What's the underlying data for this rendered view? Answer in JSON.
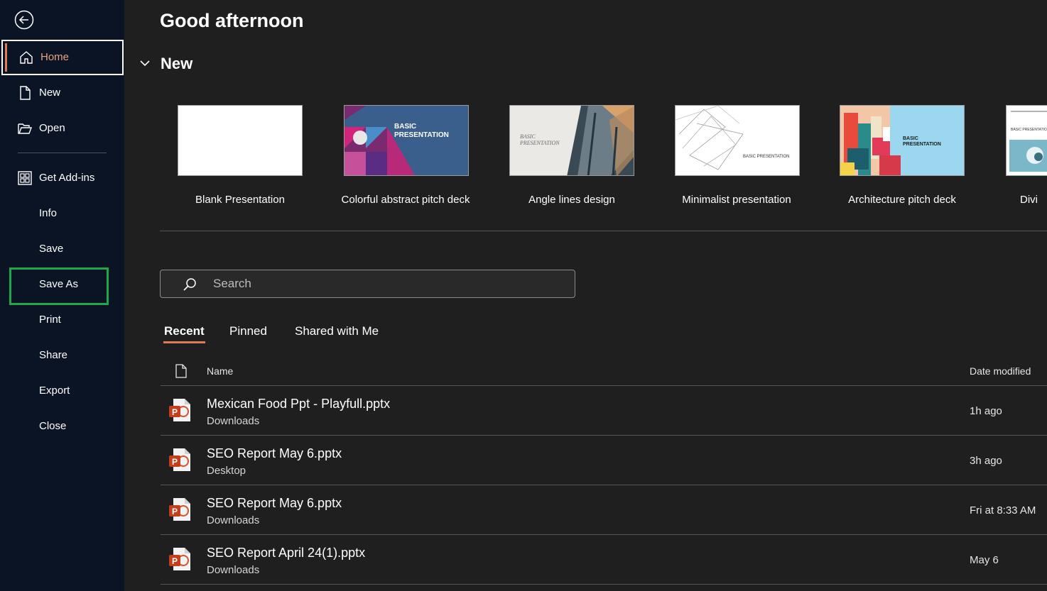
{
  "greeting": "Good afternoon",
  "sidebar": {
    "back_icon": "back-arrow-icon",
    "items": [
      {
        "label": "Home",
        "icon": "home-icon",
        "active": true
      },
      {
        "label": "New",
        "icon": "new-document-icon"
      },
      {
        "label": "Open",
        "icon": "open-folder-icon"
      },
      {
        "label": "Get Add-ins",
        "icon": "add-ins-grid-icon"
      },
      {
        "label": "Info"
      },
      {
        "label": "Save"
      },
      {
        "label": "Save As",
        "highlighted": true
      },
      {
        "label": "Print"
      },
      {
        "label": "Share"
      },
      {
        "label": "Export"
      },
      {
        "label": "Close"
      }
    ]
  },
  "new_section": {
    "title": "New",
    "templates": [
      {
        "label": "Blank Presentation"
      },
      {
        "label": "Colorful abstract pitch deck",
        "thumb_text": "BASIC\nPRESENTATION"
      },
      {
        "label": "Angle lines design",
        "thumb_text": "BASIC\nPRESENTATION"
      },
      {
        "label": "Minimalist presentation",
        "thumb_text": "BASIC PRESENTATION"
      },
      {
        "label": "Architecture pitch deck",
        "thumb_text": "BASIC\nPRESENTATION"
      },
      {
        "label": "Divi",
        "thumb_text": "BASIC PRESENTATION"
      }
    ]
  },
  "search": {
    "placeholder": "Search"
  },
  "tabs": [
    {
      "label": "Recent",
      "active": true
    },
    {
      "label": "Pinned"
    },
    {
      "label": "Shared with Me"
    }
  ],
  "columns": {
    "name": "Name",
    "date": "Date modified"
  },
  "files": [
    {
      "name": "Mexican Food Ppt - Playfull.pptx",
      "location": "Downloads",
      "date": "1h ago"
    },
    {
      "name": "SEO Report May 6.pptx",
      "location": "Desktop",
      "date": "3h ago"
    },
    {
      "name": "SEO Report May 6.pptx",
      "location": "Downloads",
      "date": "Fri at 8:33 AM"
    },
    {
      "name": "SEO Report April 24(1).pptx",
      "location": "Downloads",
      "date": "May 6"
    }
  ],
  "colors": {
    "sidebar_bg": "#0b1424",
    "main_bg": "#1f1f1f",
    "accent": "#e07c54",
    "highlight": "#1fa74a"
  }
}
